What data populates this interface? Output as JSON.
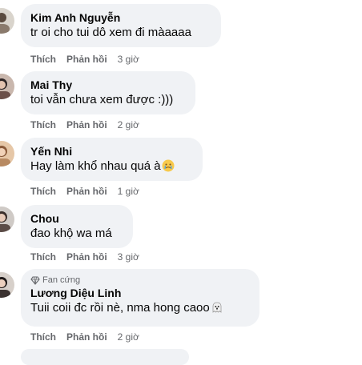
{
  "comments": [
    {
      "author": "Kim Anh Nguyễn",
      "text": "tr oi cho tui dô xem đi màaaaa",
      "like_label": "Thích",
      "reply_label": "Phản hồi",
      "time": "3 giờ",
      "avatar_icon": "avatar-photo"
    },
    {
      "author": "Mai Thy",
      "text": "toi vẫn chưa xem được :)))",
      "like_label": "Thích",
      "reply_label": "Phản hồi",
      "time": "2 giờ",
      "avatar_icon": "avatar-photo"
    },
    {
      "author": "Yến Nhi",
      "text": "Hay làm khổ nhau quá à",
      "emoji": "crying-face-icon",
      "like_label": "Thích",
      "reply_label": "Phản hồi",
      "time": "1 giờ",
      "avatar_icon": "avatar-photo"
    },
    {
      "author": "Chou",
      "text": "đao khộ wa má",
      "like_label": "Thích",
      "reply_label": "Phản hồi",
      "time": "3 giờ",
      "avatar_icon": "avatar-photo"
    },
    {
      "badge": "Fan cứng",
      "badge_icon": "diamond-icon",
      "author": "Lương Diệu Linh",
      "text": "Tuii coii đc rồi nè, nma hong caoo",
      "emoji": "ghost-icon",
      "like_label": "Thích",
      "reply_label": "Phản hồi",
      "time": "2 giờ",
      "avatar_icon": "avatar-photo"
    }
  ],
  "colors": {
    "bubble": "#f0f2f5",
    "secondary_text": "#65676b",
    "primary_text": "#050505"
  }
}
